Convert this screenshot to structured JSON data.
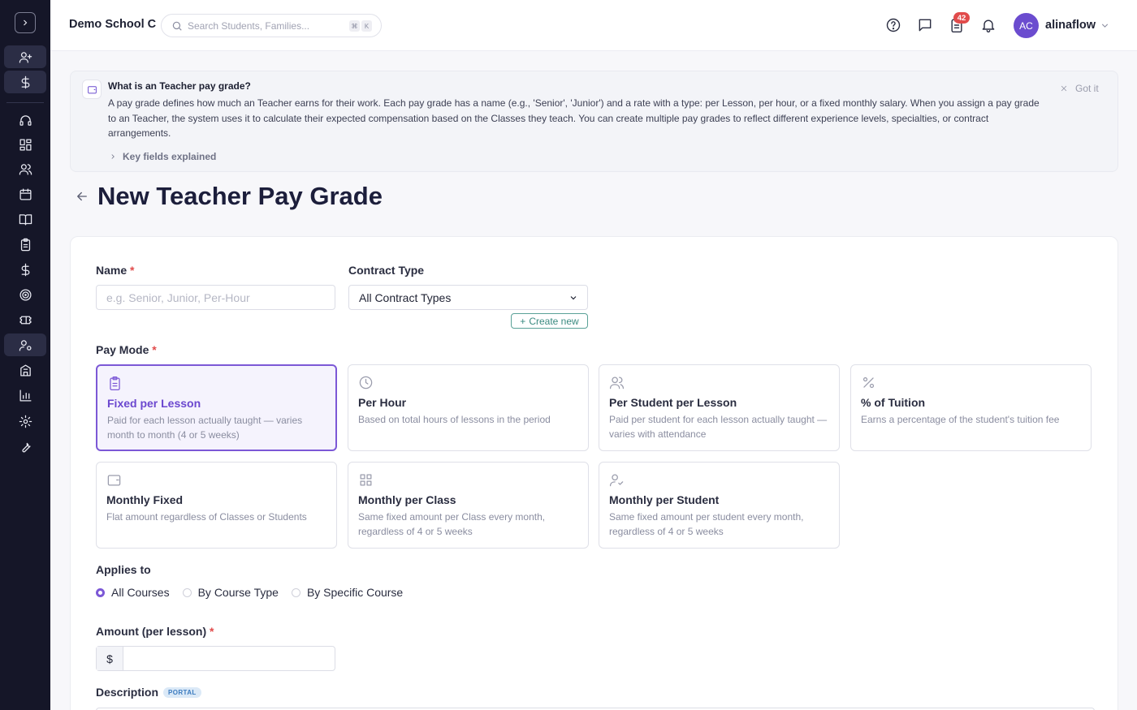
{
  "header": {
    "school": "Demo School C",
    "search_placeholder": "Search Students, Families...",
    "kbd_1": "⌘",
    "kbd_2": "K",
    "notification_count": "42",
    "avatar_initials": "AC",
    "username": "alinaflow"
  },
  "banner": {
    "title": "What is an Teacher pay grade?",
    "text": "A pay grade defines how much an Teacher earns for their work. Each pay grade has a name (e.g., 'Senior', 'Junior') and a rate with a type: per Lesson, per hour, or a fixed monthly salary. When you assign a pay grade to an Teacher, the system uses it to calculate their expected compensation based on the Classes they teach. You can create multiple pay grades to reflect different experience levels, specialties, or contract arrangements.",
    "expand_label": "Key fields explained",
    "dismiss_label": "Got it"
  },
  "page": {
    "title": "New Teacher Pay Grade"
  },
  "form": {
    "name_label": "Name",
    "name_placeholder": "e.g. Senior, Junior, Per-Hour",
    "contract_label": "Contract Type",
    "contract_value": "All Contract Types",
    "create_new_label": "Create new",
    "required_mark": "*",
    "pay_mode_label": "Pay Mode",
    "modes": [
      {
        "title": "Fixed per Lesson",
        "desc": "Paid for each lesson actually taught — varies month to month (4 or 5 weeks)",
        "icon": "clipboard-icon",
        "selected": true
      },
      {
        "title": "Per Hour",
        "desc": "Based on total hours of lessons in the period",
        "icon": "clock-icon",
        "selected": false
      },
      {
        "title": "Per Student per Lesson",
        "desc": "Paid per student for each lesson actually taught — varies with attendance",
        "icon": "users-icon",
        "selected": false
      },
      {
        "title": "% of Tuition",
        "desc": "Earns a percentage of the student's tuition fee",
        "icon": "percent-icon",
        "selected": false
      },
      {
        "title": "Monthly Fixed",
        "desc": "Flat amount regardless of Classes or Students",
        "icon": "wallet-icon",
        "selected": false
      },
      {
        "title": "Monthly per Class",
        "desc": "Same fixed amount per Class every month, regardless of 4 or 5 weeks",
        "icon": "grid-icon",
        "selected": false
      },
      {
        "title": "Monthly per Student",
        "desc": "Same fixed amount per student every month, regardless of 4 or 5 weeks",
        "icon": "user-check-icon",
        "selected": false
      }
    ],
    "applies_label": "Applies to",
    "applies_options": [
      "All Courses",
      "By Course Type",
      "By Specific Course"
    ],
    "applies_selected": "All Courses",
    "amount_label": "Amount (per lesson)",
    "currency_symbol": "$",
    "description_label": "Description",
    "portal_badge": "PORTAL"
  },
  "colors": {
    "accent": "#7c58d6",
    "sidebar": "#151628",
    "required": "#e14b4b",
    "badge": "#e14b4b",
    "teal": "#3a8a80"
  }
}
